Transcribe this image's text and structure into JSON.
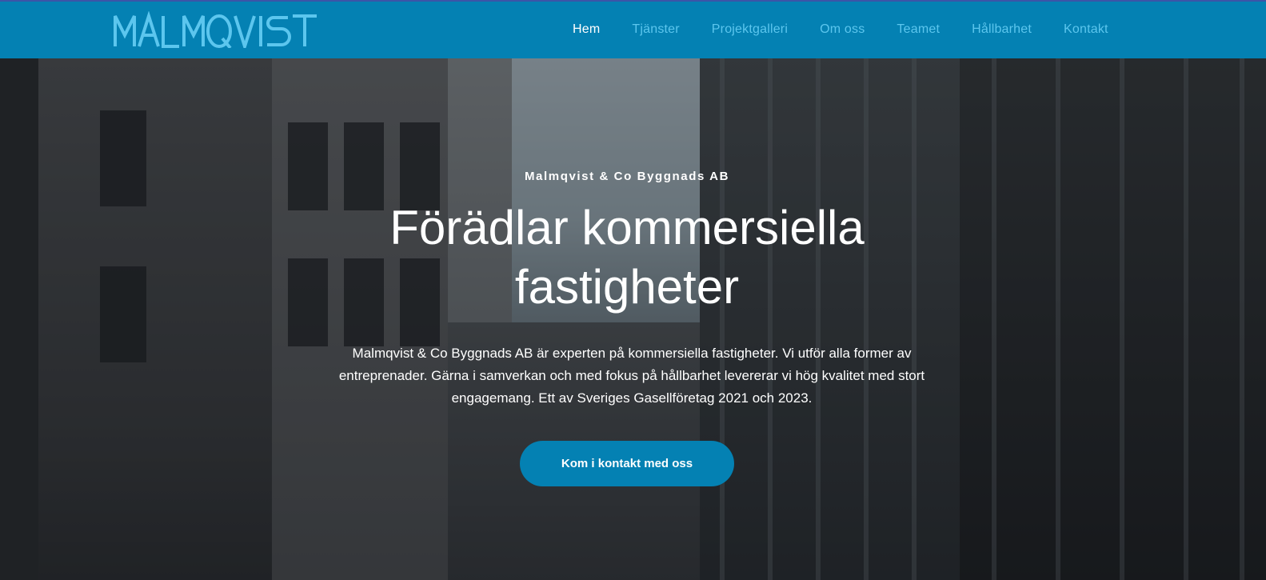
{
  "brand": {
    "logo_text": "MALMQVIST",
    "nav_color": "#0481b3",
    "nav_link_color": "#5cc6ee"
  },
  "nav": {
    "items": [
      {
        "label": "Hem",
        "active": true
      },
      {
        "label": "Tjänster",
        "active": false
      },
      {
        "label": "Projektgalleri",
        "active": false
      },
      {
        "label": "Om oss",
        "active": false
      },
      {
        "label": "Teamet",
        "active": false
      },
      {
        "label": "Hållbarhet",
        "active": false
      },
      {
        "label": "Kontakt",
        "active": false
      }
    ]
  },
  "hero": {
    "subtitle": "Malmqvist & Co Byggnads AB",
    "headline_line1": "Förädlar kommersiella",
    "headline_line2": "fastigheter",
    "intro": "Malmqvist & Co Byggnads AB är experten på kommersiella fastigheter. Vi utför alla former av entreprenader. Gärna i samverkan och med fokus på hållbarhet levererar vi hög kvalitet med stort engagemang. Ett av Sveriges Gasellföretag 2021 och 2023.",
    "cta_label": "Kom i kontakt med oss"
  }
}
